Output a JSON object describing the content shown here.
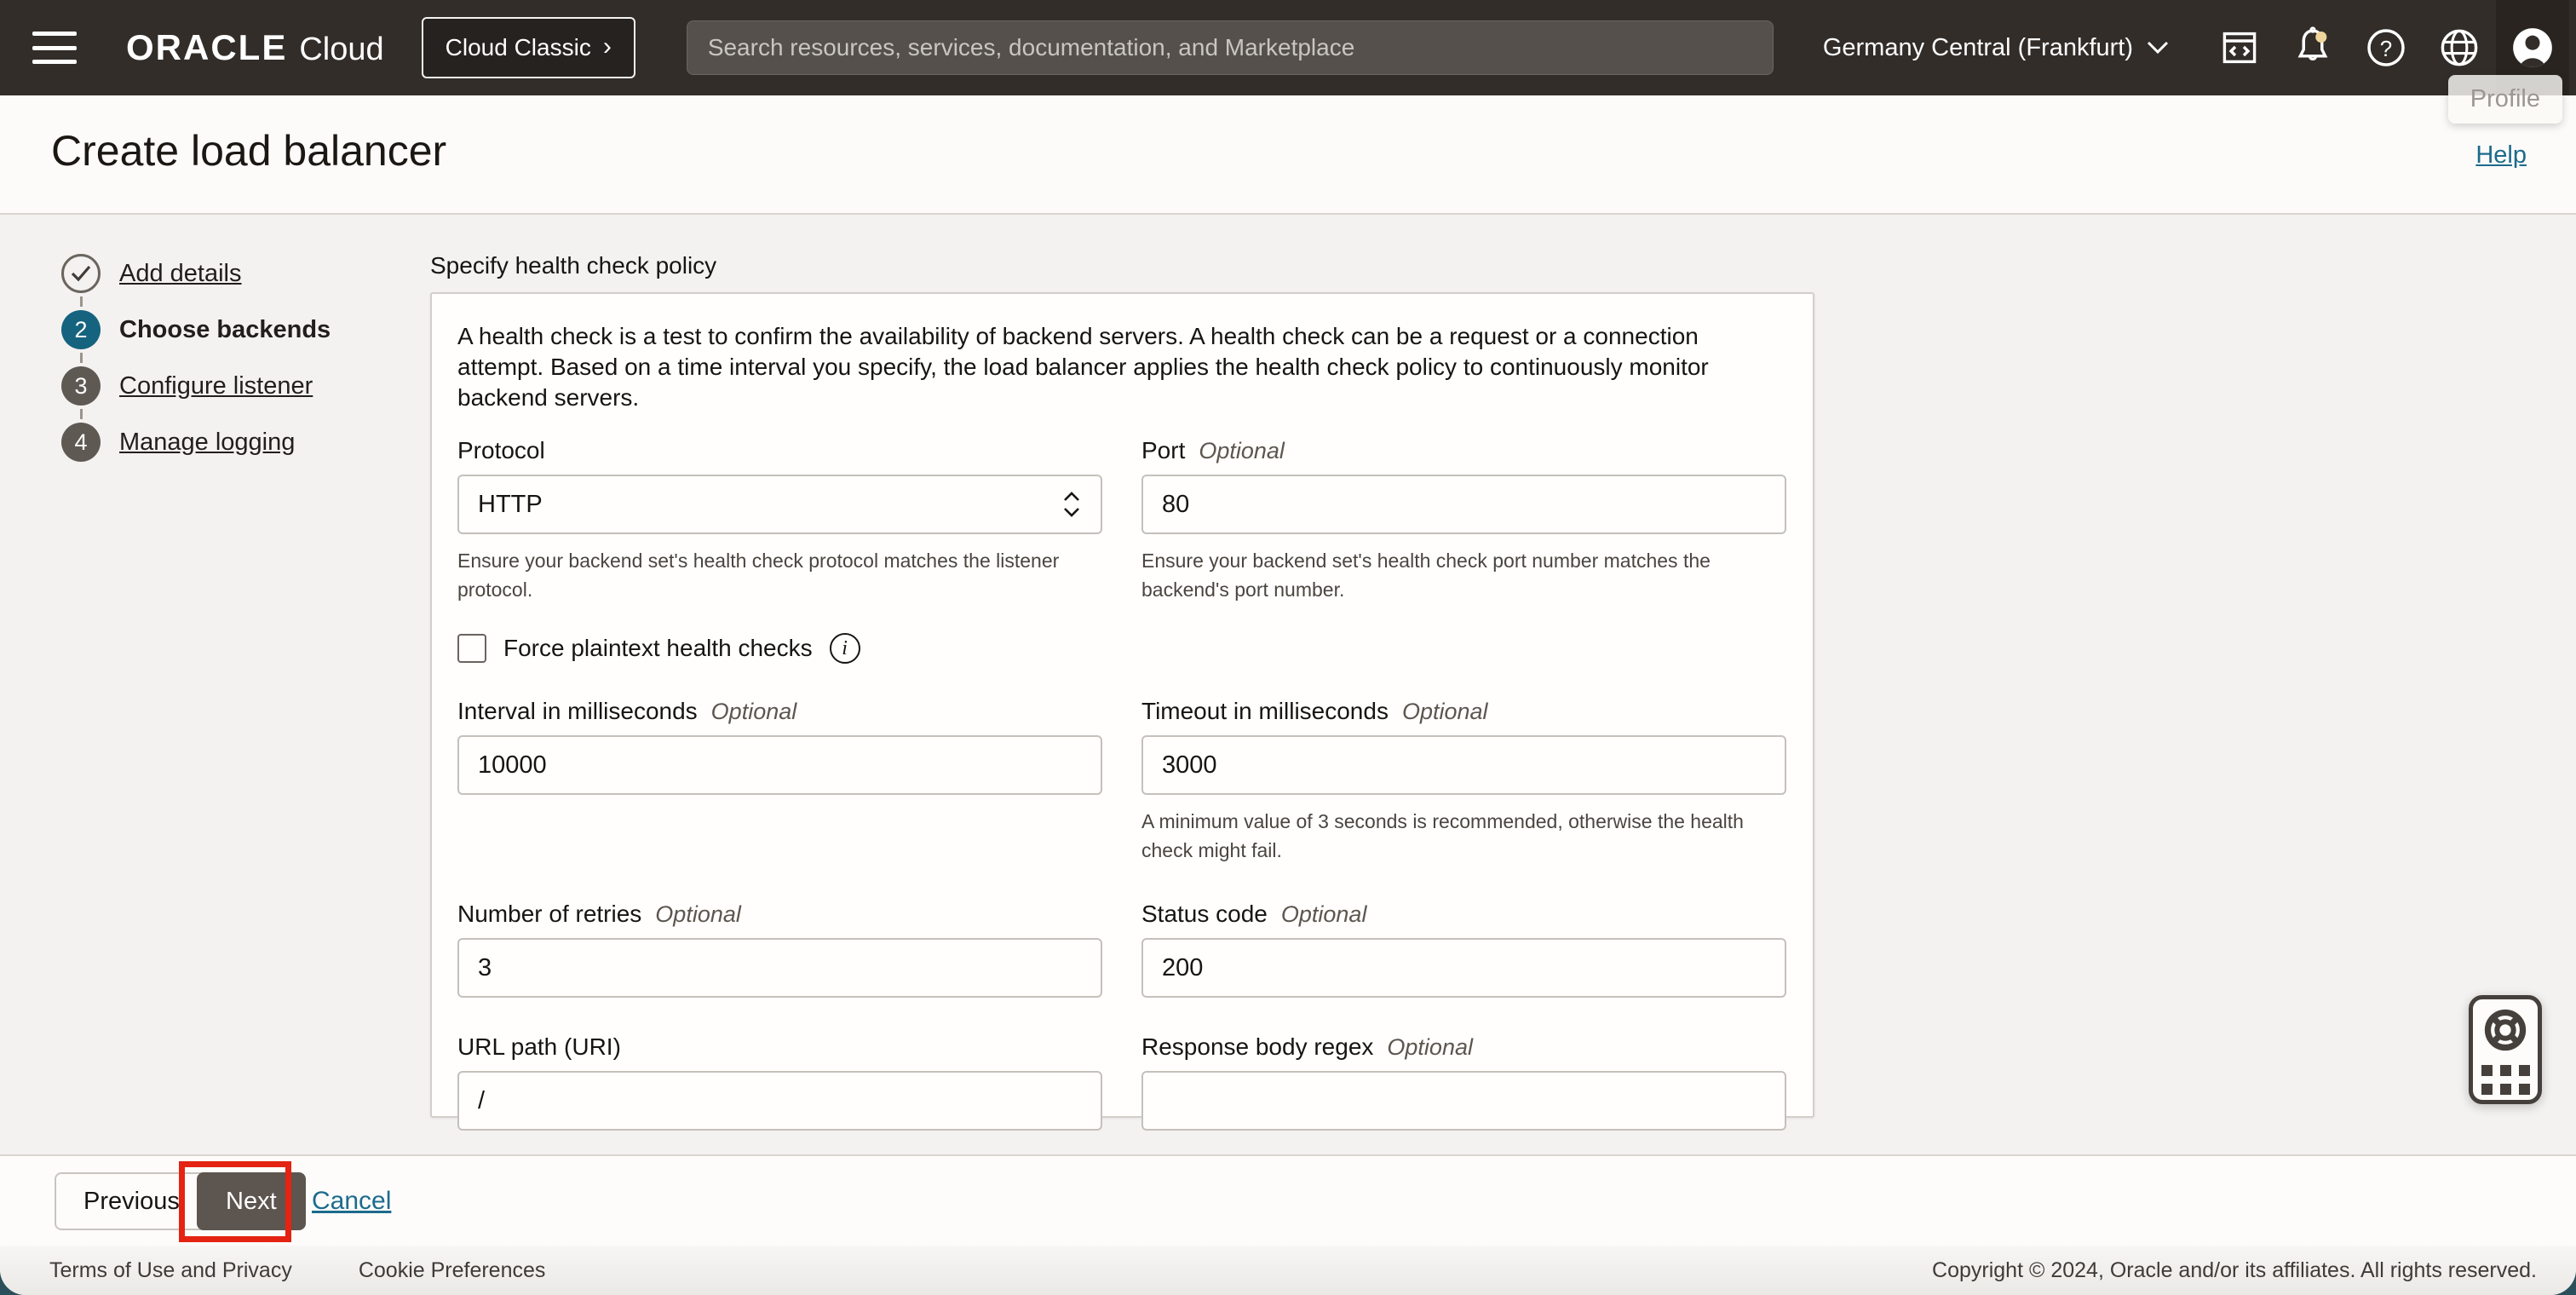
{
  "header": {
    "brand_oracle": "ORACLE",
    "brand_cloud": "Cloud",
    "cloud_classic_label": "Cloud Classic",
    "cloud_classic_chevron": "›",
    "search_placeholder": "Search resources, services, documentation, and Marketplace",
    "region_label": "Germany Central (Frankfurt)",
    "profile_tooltip": "Profile"
  },
  "page": {
    "title": "Create load balancer",
    "help_link": "Help"
  },
  "stepper": {
    "steps": [
      {
        "number": "",
        "label": "Add details",
        "state": "complete"
      },
      {
        "number": "2",
        "label": "Choose backends",
        "state": "active"
      },
      {
        "number": "3",
        "label": "Configure listener",
        "state": "upcoming"
      },
      {
        "number": "4",
        "label": "Manage logging",
        "state": "upcoming"
      }
    ]
  },
  "form": {
    "section_title": "Specify health check policy",
    "description": "A health check is a test to confirm the availability of backend servers. A health check can be a request or a connection attempt. Based on a time interval you specify, the load balancer applies the health check policy to continuously monitor backend servers.",
    "optional_label": "Optional",
    "fields": {
      "protocol": {
        "label": "Protocol",
        "value": "HTTP",
        "helper": "Ensure your backend set's health check protocol matches the listener protocol."
      },
      "port": {
        "label": "Port",
        "value": "80",
        "helper": "Ensure your backend set's health check port number matches the backend's port number."
      },
      "force_plaintext": {
        "label": "Force plaintext health checks",
        "checked": false
      },
      "interval": {
        "label": "Interval in milliseconds",
        "value": "10000"
      },
      "timeout": {
        "label": "Timeout in milliseconds",
        "value": "3000",
        "helper": "A minimum value of 3 seconds is recommended, otherwise the health check might fail."
      },
      "retries": {
        "label": "Number of retries",
        "value": "3"
      },
      "status_code": {
        "label": "Status code",
        "value": "200"
      },
      "url_path": {
        "label": "URL path (URI)",
        "value": "/"
      },
      "response_regex": {
        "label": "Response body regex",
        "value": ""
      }
    }
  },
  "actions": {
    "previous": "Previous",
    "next": "Next",
    "cancel": "Cancel"
  },
  "footer": {
    "terms": "Terms of Use and Privacy",
    "cookies": "Cookie Preferences",
    "copyright": "Copyright © 2024, Oracle and/or its affiliates. All rights reserved."
  },
  "colors": {
    "header_bg": "#322d29",
    "accent_teal": "#15637f",
    "link_teal": "#1c6b8c",
    "annotation_red": "#e42313",
    "notification_dot": "#efd59b",
    "page_corner_bg": "#2b505b"
  }
}
